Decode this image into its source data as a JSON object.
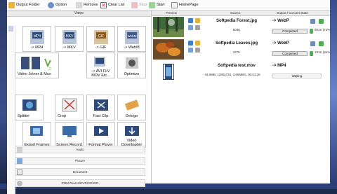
{
  "toolbar": {
    "output_folder": "Output Folder",
    "option": "Option",
    "remove": "Remove",
    "clear_list": "Clear List",
    "stop": "Stop",
    "start": "Start",
    "homepage": "HomePage"
  },
  "left": {
    "category_video": "Video",
    "tiles": [
      {
        "label": "-> MP4",
        "icon": "mp4-file-icon"
      },
      {
        "label": "-> MKV",
        "icon": "mkv-file-icon"
      },
      {
        "label": "-> GIF",
        "icon": "gif-file-icon"
      },
      {
        "label": "-> WebM",
        "icon": "webm-file-icon"
      },
      {
        "label": "Video Joiner & Mux",
        "icon": "joiner-icon"
      },
      {
        "label": "-> AVI FLV MOV Etc...",
        "icon": "avi-flv-mov-icon"
      },
      {
        "label": "Optimize",
        "icon": "optimize-icon"
      },
      {
        "label": "Splitter",
        "icon": "splitter-icon"
      },
      {
        "label": "Crop",
        "icon": "crop-icon"
      },
      {
        "label": "Fast Clip",
        "icon": "fast-clip-icon"
      },
      {
        "label": "Delogo",
        "icon": "delogo-icon"
      },
      {
        "label": "Export Frames",
        "icon": "export-frames-icon"
      },
      {
        "label": "Screen Record",
        "icon": "screen-record-icon"
      },
      {
        "label": "Format Player",
        "icon": "format-player-icon"
      },
      {
        "label": "Video Downloader",
        "icon": "video-downloader-icon"
      }
    ],
    "categories": [
      "Audio",
      "Picture",
      "Document",
      "ROM Device\\DVD\\CD\\ISO"
    ]
  },
  "right": {
    "headers": {
      "preview": "Preview",
      "source": "Source",
      "output": "Output / Convert State"
    },
    "rows": [
      {
        "name": "Softpedia Forest.jpg",
        "info": "604K",
        "target": "-> WebP",
        "status": "Completed",
        "size": "501K (73%)",
        "status_color": "#e8e8e8"
      },
      {
        "name": "Softpedia Leaves.jpg",
        "info": "227K",
        "target": "-> WebP",
        "status": "Completed",
        "size": "191K (84%)",
        "status_color": "#e8e8e8"
      },
      {
        "name": "Softpedia test.mov",
        "info": "44.6MB, 1280x720, 3.66MB/s, 00:01:35",
        "target": "-> MP4",
        "status": "Waiting",
        "size": "",
        "status_color": "#f4f4f4"
      }
    ]
  }
}
